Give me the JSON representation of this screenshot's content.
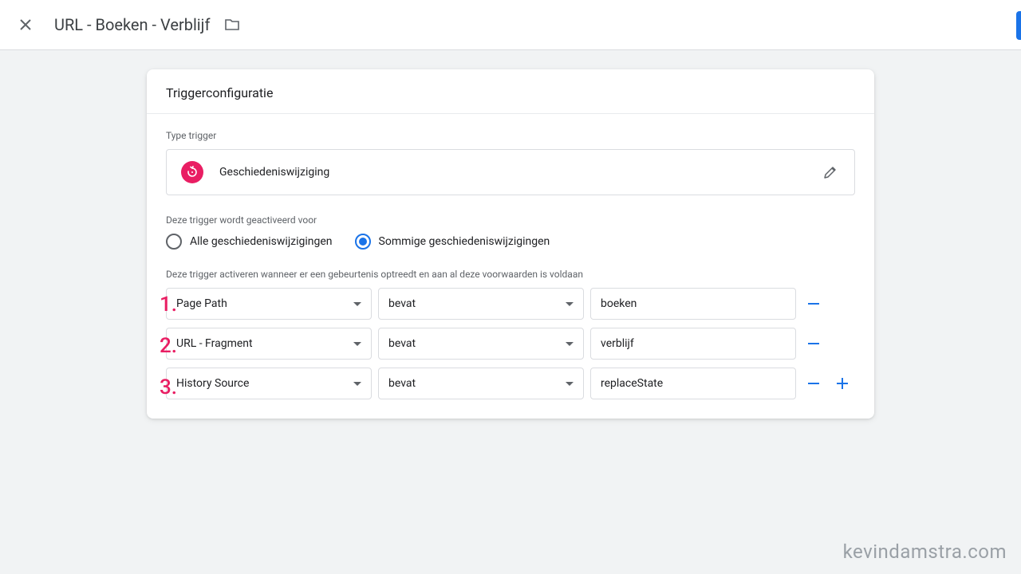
{
  "header": {
    "title": "URL - Boeken - Verblijf"
  },
  "card": {
    "title": "Triggerconfiguratie",
    "typeLabel": "Type trigger",
    "triggerName": "Geschiedeniswijziging",
    "activationLabel": "Deze trigger wordt geactiveerd voor",
    "radioAll": "Alle geschiedeniswijzigingen",
    "radioSome": "Sommige geschiedeniswijzigingen",
    "conditionsLabel": "Deze trigger activeren wanneer er een gebeurtenis optreedt en aan al deze voorwaarden is voldaan",
    "conditions": [
      {
        "variable": "Page Path",
        "operator": "bevat",
        "value": "boeken"
      },
      {
        "variable": "URL - Fragment",
        "operator": "bevat",
        "value": "verblijf"
      },
      {
        "variable": "History Source",
        "operator": "bevat",
        "value": "replaceState"
      }
    ]
  },
  "annotations": [
    "1.",
    "2.",
    "3."
  ],
  "watermark": "kevindamstra.com"
}
